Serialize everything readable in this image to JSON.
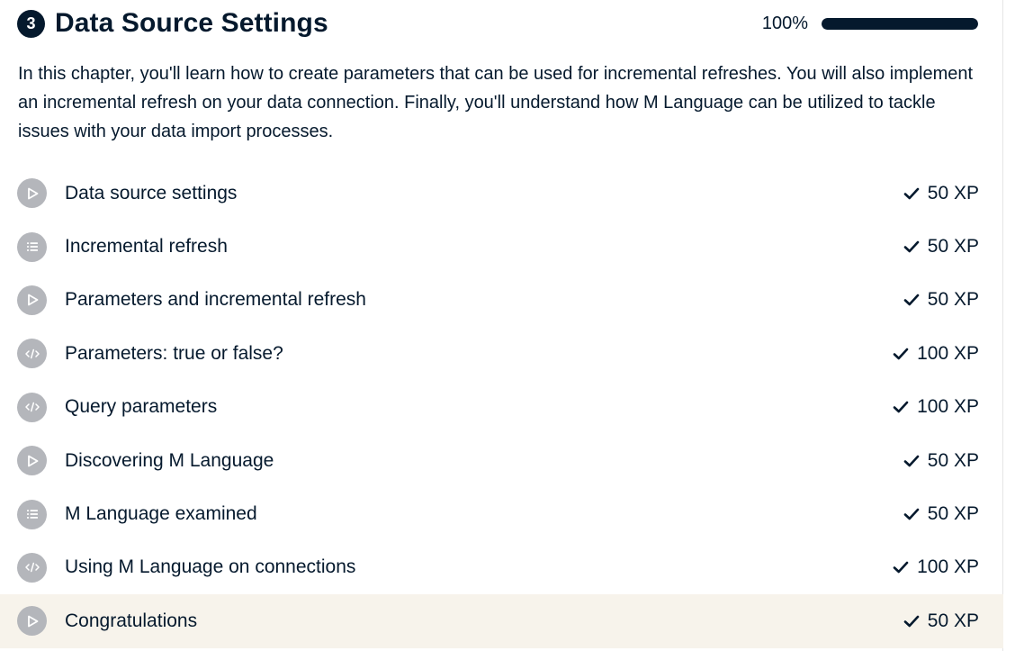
{
  "chapter": {
    "number": "3",
    "title": "Data Source Settings",
    "progress_label": "100%",
    "progress_fraction": 1.0,
    "description": "In this chapter, you'll learn how to create parameters that can be used for incremental refreshes. You will also implement an incremental refresh on your data connection. Finally, you'll understand how M Language can be utilized to tackle issues with your data import processes."
  },
  "lessons": [
    {
      "title": "Data source settings",
      "type": "video",
      "xp": "50 XP",
      "completed": true
    },
    {
      "title": "Incremental refresh",
      "type": "multiple-choice",
      "xp": "50 XP",
      "completed": true
    },
    {
      "title": "Parameters and incremental refresh",
      "type": "video",
      "xp": "50 XP",
      "completed": true
    },
    {
      "title": "Parameters: true or false?",
      "type": "exercise",
      "xp": "100 XP",
      "completed": true
    },
    {
      "title": "Query parameters",
      "type": "exercise",
      "xp": "100 XP",
      "completed": true
    },
    {
      "title": "Discovering M Language",
      "type": "video",
      "xp": "50 XP",
      "completed": true
    },
    {
      "title": "M Language examined",
      "type": "multiple-choice",
      "xp": "50 XP",
      "completed": true
    },
    {
      "title": "Using M Language on connections",
      "type": "exercise",
      "xp": "100 XP",
      "completed": true
    },
    {
      "title": "Congratulations",
      "type": "video",
      "xp": "50 XP",
      "completed": true,
      "highlighted": true
    }
  ],
  "colors": {
    "text": "#05192d",
    "icon_bg": "#b4b6bb",
    "highlight_bg": "#f7f3eb",
    "progress_track": "#d9d9e2"
  }
}
